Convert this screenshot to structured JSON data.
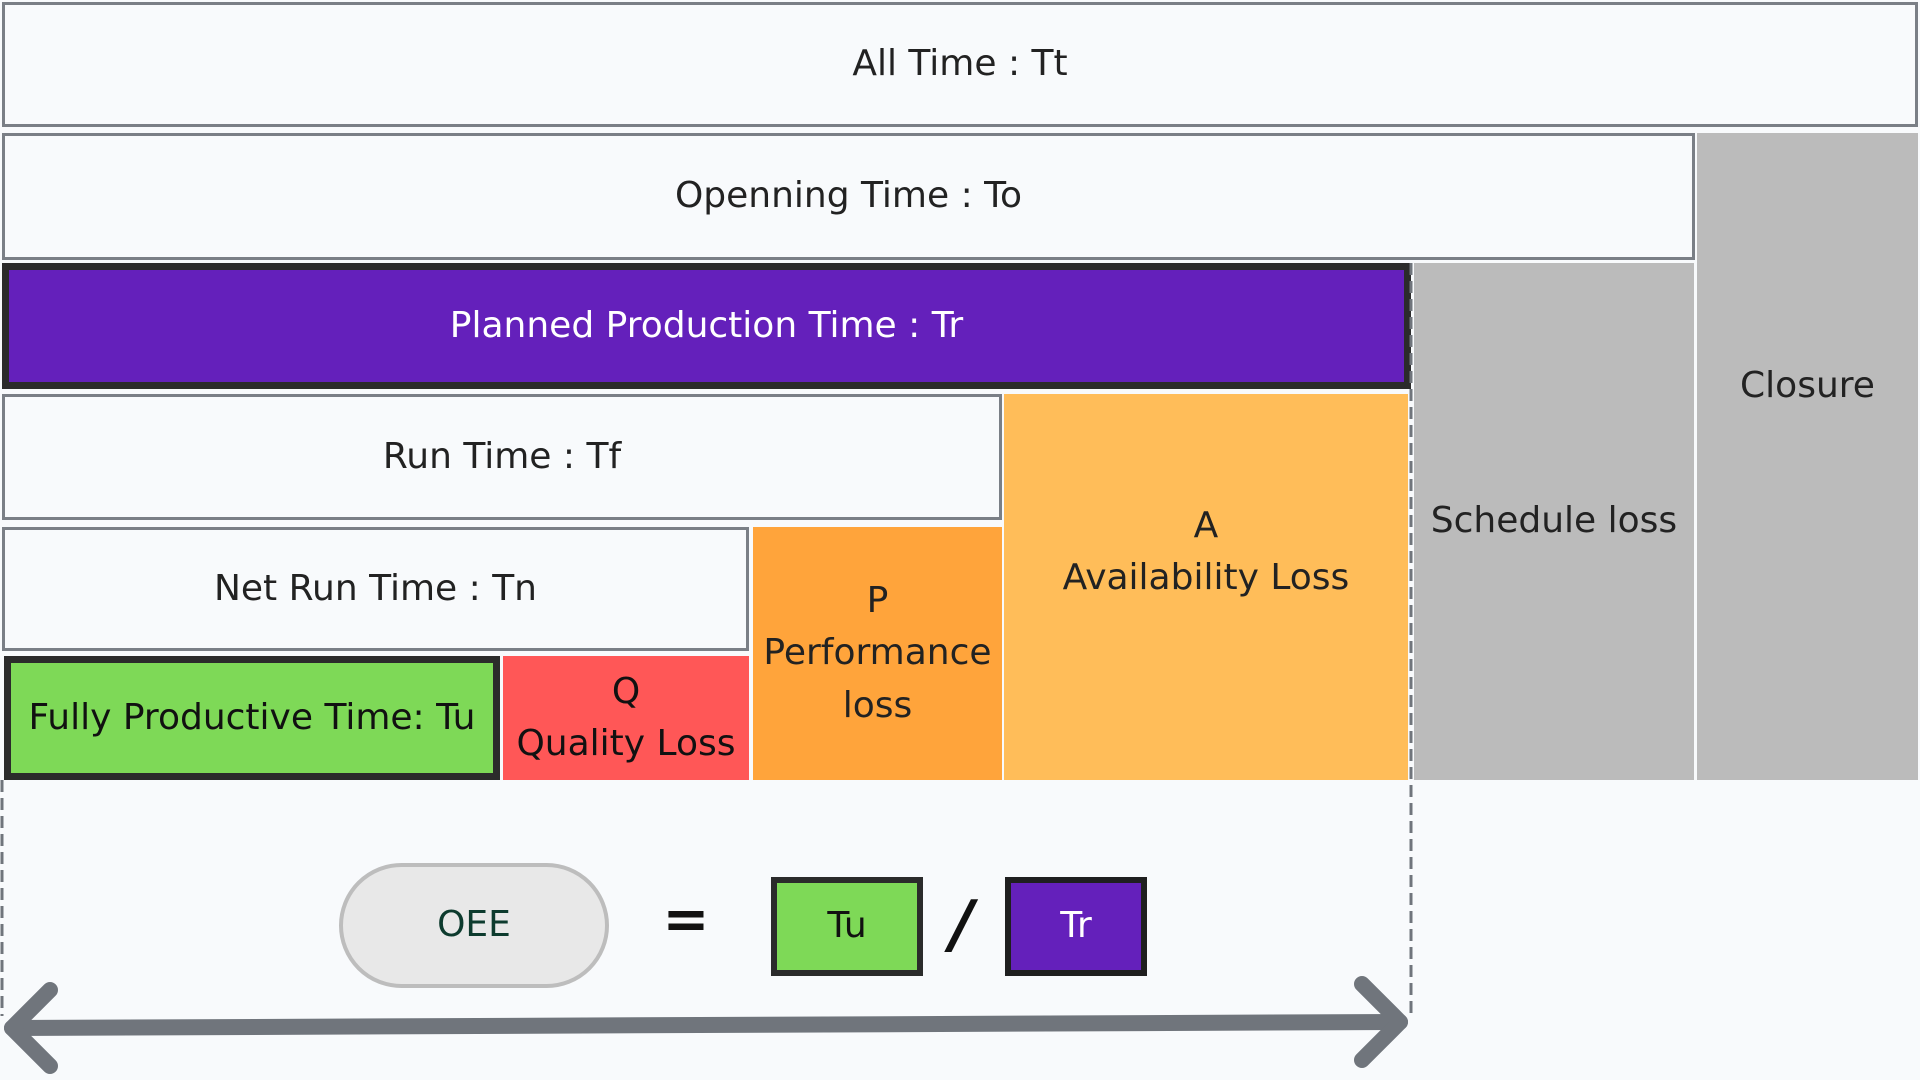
{
  "blocks": {
    "all_time": "All Time : Tt",
    "opening_time": "Openning Time : To",
    "closure": "Closure",
    "planned_production_time": "Planned Production Time : Tr",
    "schedule_loss": "Schedule loss",
    "run_time": "Run Time : Tf",
    "availability_loss": "A\nAvailability Loss",
    "net_run_time": "Net Run Time : Tn",
    "performance_loss": "P\nPerformance\nloss",
    "fully_productive_time": "Fully Productive Time: Tu",
    "quality_loss": "Q\nQuality Loss"
  },
  "formula": {
    "lhs": "OEE",
    "equals": "=",
    "numerator": "Tu",
    "divide": "/",
    "denominator": "Tr"
  },
  "colors": {
    "planned": "#6420bb",
    "fully_productive": "#7ed957",
    "quality": "#ff5757",
    "performance": "#ffa43b",
    "availability": "#ffbd59",
    "loss_gray": "#bbbbbb",
    "arrow": "#70757c"
  }
}
